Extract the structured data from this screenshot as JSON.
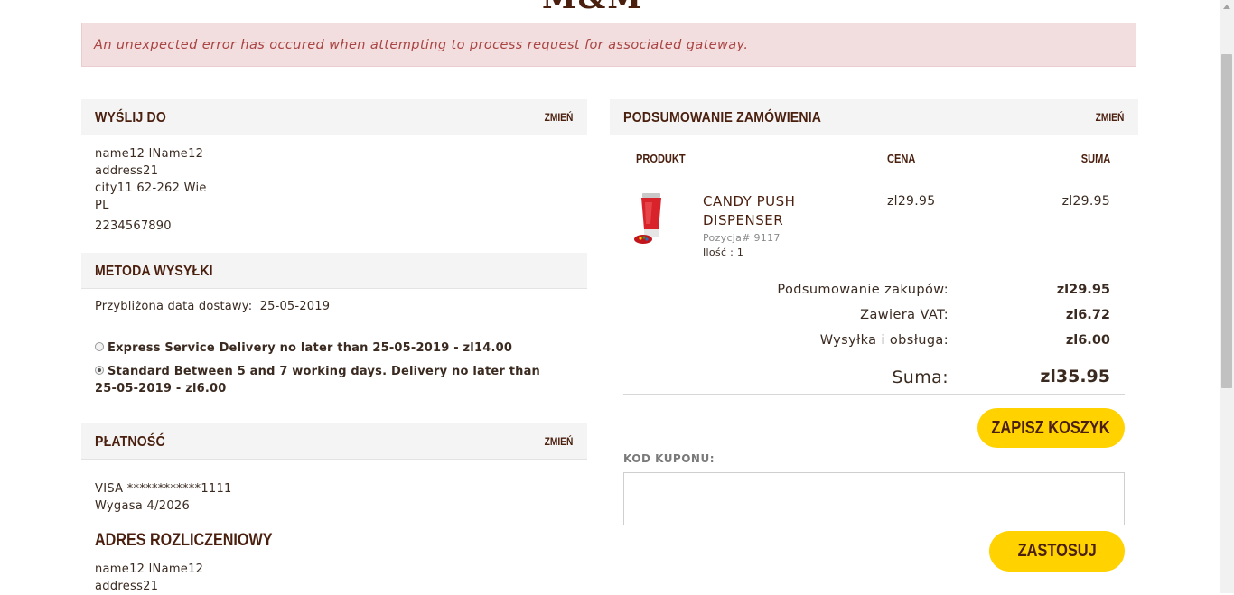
{
  "error": {
    "message": "An unexpected error has occured when attempting to process request for associated gateway."
  },
  "ship_to": {
    "title": "WYŚLIJ DO",
    "change": "ZMIEŃ",
    "name": "name12 lName12",
    "address": "address21",
    "city": "city11 62-262 Wie",
    "country": "PL",
    "phone": "2234567890"
  },
  "shipping_method": {
    "title": "METODA WYSYŁKI",
    "estimated_label": "Przybliżona data dostawy:",
    "estimated_date": "25-05-2019",
    "options": [
      {
        "label": "Express Service Delivery no later than 25-05-2019 - zl14.00",
        "selected": false
      },
      {
        "label": "Standard Between 5 and 7 working days. Delivery no later than 25-05-2019 - zl6.00",
        "selected": true
      }
    ]
  },
  "payment": {
    "title": "PŁATNOŚĆ",
    "change": "ZMIEŃ",
    "card": "VISA ************1111",
    "expiry": "Wygasa 4/2026",
    "billing_title": "ADRES ROZLICZENIOWY",
    "billing_name": "name12 lName12",
    "billing_address": "address21"
  },
  "order_summary": {
    "title": "PODSUMOWANIE ZAMÓWIENIA",
    "change": "ZMIEŃ",
    "col_product": "PRODUKT",
    "col_price": "CENA",
    "col_total": "SUMA",
    "item": {
      "name": "CANDY PUSH DISPENSER",
      "item_no": "Pozycja# 9117",
      "qty": "Ilość : 1",
      "price": "zl29.95",
      "total": "zl29.95",
      "image_icon": "product-tube-image"
    },
    "subtotal_label": "Podsumowanie zakupów:",
    "subtotal_value": "zl29.95",
    "vat_label": "Zawiera VAT:",
    "vat_value": "zl6.72",
    "shipping_label": "Wysyłka i obsługa:",
    "shipping_value": "zl6.00",
    "total_label": "Suma:",
    "total_value": "zl35.95",
    "save_cart": "ZAPISZ KOSZYK",
    "coupon_label": "KOD KUPONU:",
    "coupon_value": "",
    "apply": "ZASTOSUJ"
  },
  "colors": {
    "accent_yellow": "#ffd200",
    "brand_brown": "#4a1f0e",
    "error_bg": "#f2dede",
    "error_text": "#a94442"
  }
}
